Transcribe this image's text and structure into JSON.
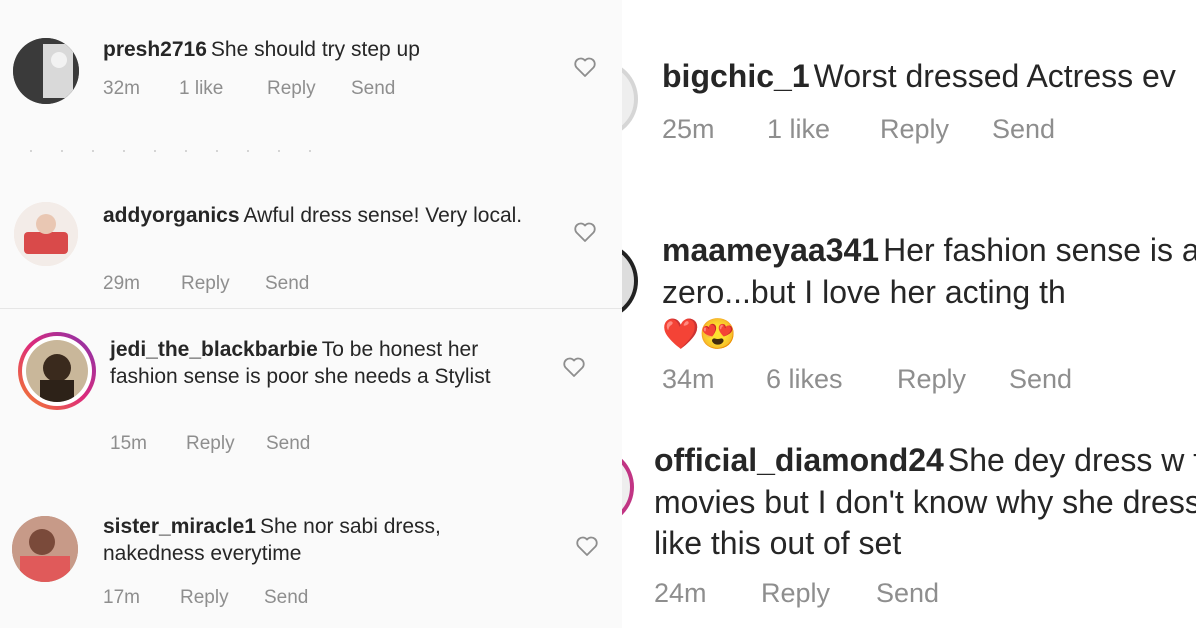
{
  "left_comments": [
    {
      "user": "presh2716",
      "text": "She should try step up",
      "time": "32m",
      "likes": "1 like",
      "reply": "Reply",
      "send": "Send"
    },
    {
      "user": "addyorganics",
      "text": "Awful dress sense! Very local.",
      "time": "29m",
      "likes": "",
      "reply": "Reply",
      "send": "Send"
    },
    {
      "user": "jedi_the_blackbarbie",
      "text": "To be honest her fashion sense is poor she needs a Stylist",
      "time": "15m",
      "likes": "",
      "reply": "Reply",
      "send": "Send"
    },
    {
      "user": "sister_miracle1",
      "text": "She nor sabi dress, nakedness everytime",
      "time": "17m",
      "likes": "",
      "reply": "Reply",
      "send": "Send"
    }
  ],
  "right_comments": [
    {
      "user": "bigchic_1",
      "text": "Worst dressed Actress ev",
      "time": "25m",
      "likes": "1 like",
      "reply": "Reply",
      "send": "Send"
    },
    {
      "user": "maameyaa341",
      "text": "Her fashion sense is always zero...but I love her acting th",
      "emoji": "❤️😍",
      "time": "34m",
      "likes": "6 likes",
      "reply": "Reply",
      "send": "Send"
    },
    {
      "user": "official_diamond24",
      "text": "She dey dress w for movies but I don't know why she dresses like this out of set",
      "time": "24m",
      "likes": "",
      "reply": "Reply",
      "send": "Send"
    }
  ],
  "colors": {
    "meta": "#8e8e8e",
    "story_ring_start": "#f58529",
    "story_ring_end": "#c13584"
  }
}
